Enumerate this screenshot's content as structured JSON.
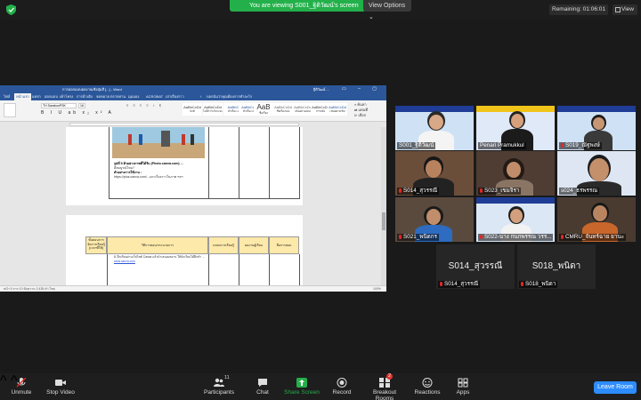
{
  "banner": {
    "text": "You are viewing S001_ฐิติวัฒน์'s screen",
    "view_options": "View Options ⌄"
  },
  "timer": {
    "label": "Remaining: 01:06:01"
  },
  "view_button": {
    "label": "View"
  },
  "word": {
    "doc_title": "การออกแบบผลงานเชิงสุ่มสี [...] - Word",
    "user": "ฐิติวัฒน์ ...",
    "tabs": [
      "ไฟล์",
      "หน้าแรก",
      "แทรก",
      "ออกแบบ",
      "เค้าโครง",
      "การอ้างอิง",
      "จดหมาย",
      "ตรวจทาน",
      "มุมมอง",
      "ACROBAT",
      "เล่าเรื่องราว",
      "บอกฉัน"
    ],
    "search_hint": "บอกฉันว่าคุณต้องการทำอะไร",
    "font": "TH SarabunPSK",
    "font_size": "16",
    "styles": [
      {
        "sample": "AaBbCcDd",
        "name": "ปกติ"
      },
      {
        "sample": "AaBbCcDd",
        "name": "ไม่มีการเว้นระยะ"
      },
      {
        "sample": "AaBbC",
        "name": "หัวเรื่อง 1"
      },
      {
        "sample": "AaBbCcI",
        "name": "หัวเรื่อง 2"
      },
      {
        "sample": "AaB",
        "name": "ชื่อเรื่อง"
      },
      {
        "sample": "AaBbCcDd",
        "name": "ชื่อเรื่องรอง"
      },
      {
        "sample": "AaBbCcDd",
        "name": "เน้นอย่างอ่อน"
      },
      {
        "sample": "AaBbCcDd",
        "name": "การเน้น"
      },
      {
        "sample": "AaBbCcDd",
        "name": "เน้นอย่างเข้ม"
      }
    ],
    "find": "ค้นหา",
    "replace": "แทนที่",
    "select": "เลือก",
    "page1": {
      "caption": "รูปที่ 5 ตัวอย่างภาพที่ได้รับ (Photo.canva.com) ...",
      "caption_tail": "ดีสมบูรณ์ไหม?",
      "sub_heading": "ตัวอย่างการใช้งาน :",
      "body": "https://plus.canva.com/...แกะเรื่องราวในภาพ ฯลฯ"
    },
    "page2": {
      "headers": [
        "ขั้นตอนการจัดการเรียนรู้ (เวลาที่ใช้)",
        "วิธีการสอน/กระบวนการ",
        "แหล่งการเรียนรู้",
        "ผลงานผู้เรียน",
        "สื่อการสอน"
      ],
      "body": "8. ฝึกเรียนผ่านเว็บไซต์ Canva แล้วนำเสนอผลงาน ให้นักเรียนได้ฝึกทำ ...",
      "link": "www.canva.com"
    },
    "status": "หน้า 9 จาก 10   ข้อความ 2,435 คำ   ไทย",
    "zoom": "100%"
  },
  "participants_gallery": [
    {
      "name": "S001_ฐิติวัฒน์",
      "muted": false
    },
    {
      "name": "Penari Pramukkul",
      "muted": false
    },
    {
      "name": "S019_ณัฐพงษ์",
      "muted": true
    },
    {
      "name": "S014_สุวรรณี",
      "muted": true
    },
    {
      "name": "S023_เขมจิรา",
      "muted": true
    },
    {
      "name": "s024_ธรพรรณ",
      "muted": false
    },
    {
      "name": "S021_พนิดกร",
      "muted": true
    },
    {
      "name": "S022-นาง กนกพรรณ วรร...",
      "muted": true
    },
    {
      "name": "CMRU_จันทร์ฉาย ยานะ",
      "muted": true
    }
  ],
  "name_tiles": [
    {
      "display": "S014_สุวรรณี",
      "label": "S014_สุวรรณี"
    },
    {
      "display": "S018_พนิดา",
      "label": "S018_พนิดา"
    }
  ],
  "toolbar": {
    "unmute": "Unmute",
    "stop_video": "Stop Video",
    "participants": "Participants",
    "participants_count": "11",
    "chat": "Chat",
    "share_screen": "Share Screen",
    "record": "Record",
    "breakout_rooms": "Breakout Rooms",
    "breakout_badge": "2",
    "reactions": "Reactions",
    "apps": "Apps",
    "leave": "Leave Room"
  },
  "colors": {
    "share_green": "#23b04a",
    "word_blue": "#2b579a",
    "leave_blue": "#2d8cff",
    "active_speaker": "#d9e21f"
  }
}
